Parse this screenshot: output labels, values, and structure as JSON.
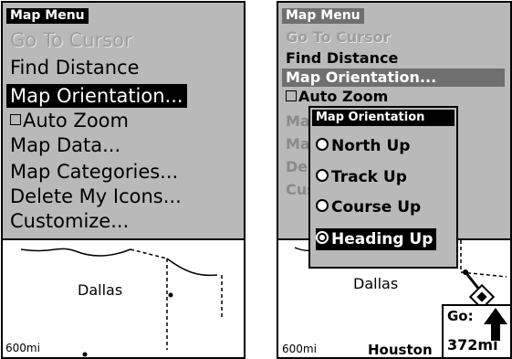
{
  "left": {
    "menu": {
      "title": "Map Menu",
      "items": [
        {
          "label": "Go To Cursor",
          "state": "disabled"
        },
        {
          "label": "Find Distance",
          "state": "normal"
        },
        {
          "label": "Map Orientation...",
          "state": "selected"
        },
        {
          "label": "Auto Zoom",
          "state": "checkbox"
        },
        {
          "label": "Map Data...",
          "state": "normal"
        },
        {
          "label": "Map Categories...",
          "state": "normal"
        },
        {
          "label": "Delete My Icons...",
          "state": "normal"
        },
        {
          "label": "Customize...",
          "state": "normal"
        }
      ]
    },
    "map": {
      "city": "Dallas",
      "scale": "600mi"
    }
  },
  "right": {
    "menu": {
      "title": "Map Menu",
      "items": [
        {
          "label": "Go To Cursor",
          "state": "disabled"
        },
        {
          "label": "Find Distance",
          "state": "normal"
        },
        {
          "label": "Map Orientation...",
          "state": "selected"
        },
        {
          "label": "Auto Zoom",
          "state": "checkbox"
        },
        {
          "label": "Map Data...",
          "state": "dim"
        },
        {
          "label": "Map Categories...",
          "state": "dim"
        },
        {
          "label": "Delete My Icons...",
          "state": "dim"
        },
        {
          "label": "Customize...",
          "state": "dim"
        }
      ]
    },
    "popup": {
      "title": "Map Orientation",
      "options": [
        {
          "label": "North Up",
          "selected": false
        },
        {
          "label": "Track Up",
          "selected": false
        },
        {
          "label": "Course Up",
          "selected": false
        },
        {
          "label": "Heading Up",
          "selected": true
        }
      ]
    },
    "map": {
      "city": "Dallas",
      "scale": "600mi",
      "city2": "Houston",
      "go_label": "Go:",
      "go_value": "372mi"
    }
  }
}
